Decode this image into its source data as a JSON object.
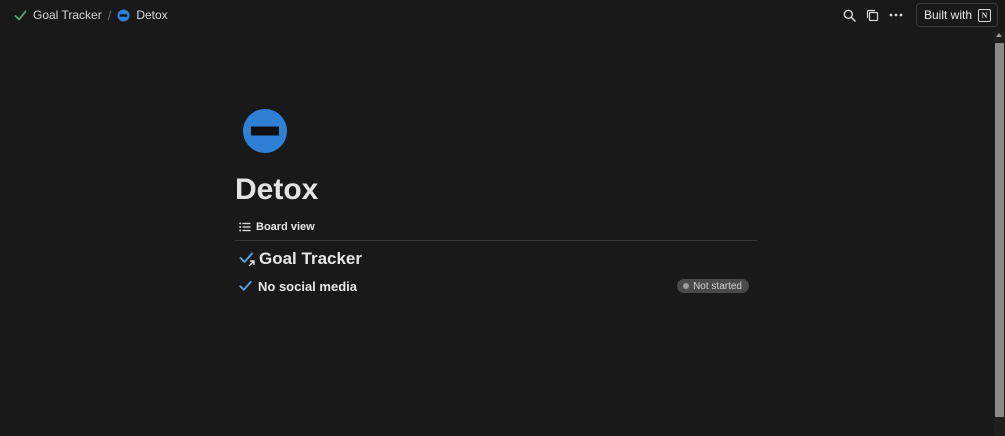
{
  "breadcrumb": {
    "parent_label": "Goal Tracker",
    "separator": "/",
    "current_label": "Detox"
  },
  "topbar": {
    "built_with_label": "Built with",
    "notion_logo_letter": "N"
  },
  "page": {
    "title": "Detox",
    "icon": "no-entry-icon",
    "view_tab_label": "Board view",
    "group": {
      "title": "Goal Tracker"
    },
    "rows": [
      {
        "title": "No social media",
        "status": "Not started"
      }
    ]
  },
  "colors": {
    "background": "#191919",
    "accent_blue": "#2f7fd6",
    "check_green": "#4fa07a",
    "check_blue": "#5aa5e8",
    "status_badge_bg": "#4a4a4a"
  }
}
